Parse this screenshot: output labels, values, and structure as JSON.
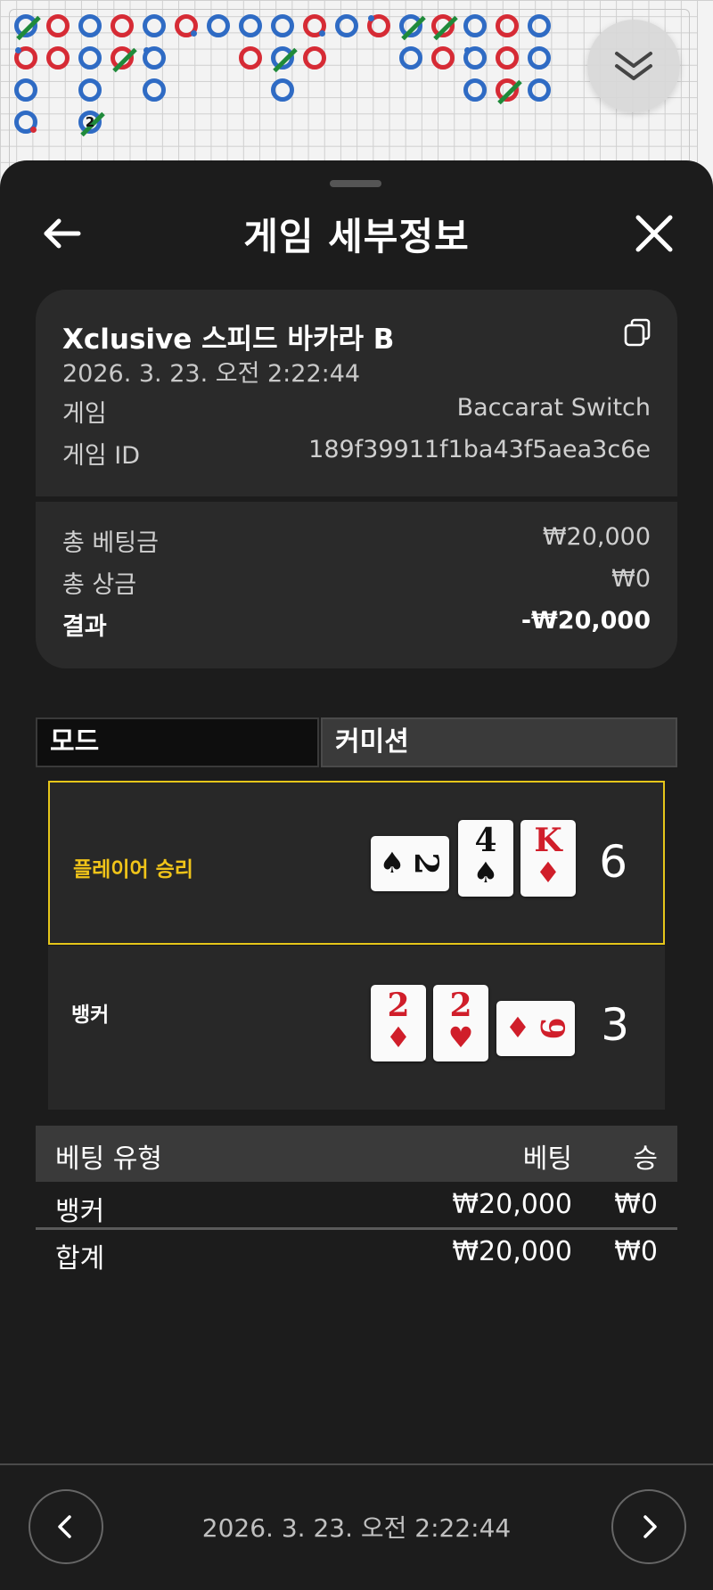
{
  "roadmap": {
    "collapse_icon": "chevron-double-down-icon",
    "tie_count_label": "2"
  },
  "header": {
    "title": "게임 세부정보",
    "back_icon": "arrow-left-icon",
    "close_icon": "close-icon"
  },
  "game": {
    "name": "Xclusive 스피드 바카라 B",
    "datetime": "2026. 3. 23. 오전 2:22:44",
    "copy_icon": "copy-icon",
    "game_label": "게임",
    "game_value": "Baccarat Switch",
    "id_label": "게임 ID",
    "id_value": "189f39911f1ba43f5aea3c6e"
  },
  "summary": {
    "total_bet_label": "총 베팅금",
    "total_bet_value": "₩20,000",
    "total_win_label": "총 상금",
    "total_win_value": "₩0",
    "result_label": "결과",
    "result_value": "-₩20,000"
  },
  "tabs": {
    "mode": "모드",
    "commission": "커미션"
  },
  "results": {
    "player": {
      "label": "플레이어 승리",
      "score": "6",
      "cards": [
        {
          "rank": "2",
          "suit": "♠"
        },
        {
          "rank": "4",
          "suit": "♠"
        },
        {
          "rank": "K",
          "suit": "♦"
        }
      ]
    },
    "banker": {
      "label": "뱅커",
      "score": "3",
      "cards": [
        {
          "rank": "2",
          "suit": "♦"
        },
        {
          "rank": "2",
          "suit": "♥"
        },
        {
          "rank": "9",
          "suit": "♦"
        }
      ]
    }
  },
  "bets": {
    "headers": {
      "type": "베팅 유형",
      "bet": "베팅",
      "win": "승"
    },
    "rows": [
      {
        "type": "뱅커",
        "bet": "₩20,000",
        "win": "₩0"
      }
    ],
    "total": {
      "type": "합계",
      "bet": "₩20,000",
      "win": "₩0"
    }
  },
  "footer": {
    "datetime": "2026. 3. 23. 오전 2:22:44",
    "prev_icon": "chevron-left-icon",
    "next_icon": "chevron-right-icon"
  },
  "colors": {
    "player_blue": "#2f6bc4",
    "banker_red": "#d62b35",
    "tie_green": "#1f8a3a",
    "win_highlight": "#e6c61a",
    "sheet_bg": "#1c1c1c"
  }
}
